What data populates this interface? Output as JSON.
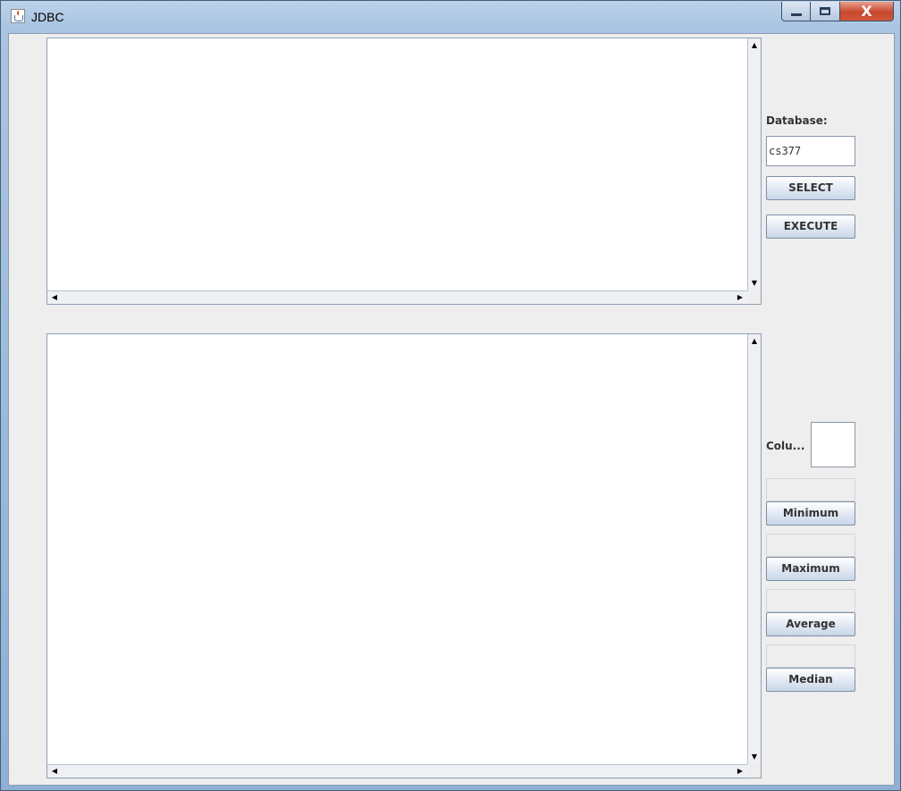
{
  "window": {
    "title": "JDBC",
    "min_glyph": "",
    "max_glyph": "",
    "close_glyph": "X"
  },
  "query_pane": {
    "text": "",
    "scroll_up": "▲",
    "scroll_down": "▼",
    "scroll_left": "◀",
    "scroll_right": "▶"
  },
  "result_pane": {
    "text": "",
    "scroll_up": "▲",
    "scroll_down": "▼",
    "scroll_left": "◀",
    "scroll_right": "▶"
  },
  "controls": {
    "database_label": "Database:",
    "database_value": "cs377",
    "select_label": "SELECT",
    "execute_label": "EXECUTE",
    "column_label": "Colu...",
    "column_value": "",
    "minimum_label": "Minimum",
    "maximum_label": "Maximum",
    "average_label": "Average",
    "median_label": "Median",
    "minimum_result": "",
    "maximum_result": "",
    "average_result": "",
    "median_result": ""
  },
  "icons": {
    "app": "java-icon"
  }
}
